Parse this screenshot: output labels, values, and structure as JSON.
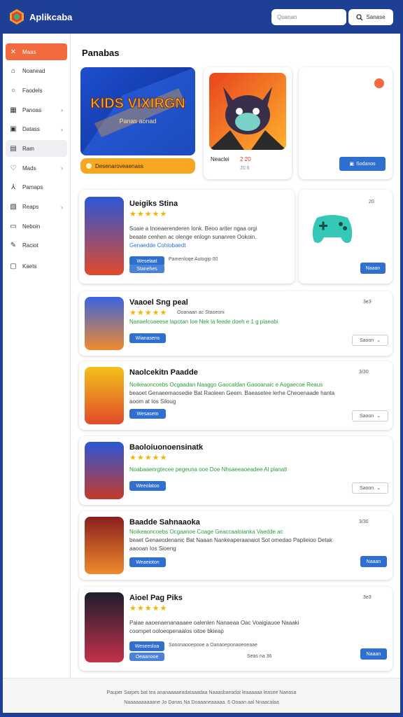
{
  "app": {
    "title": "Aplikcaba"
  },
  "header": {
    "search_placeholder": "Quanan",
    "search_button": "Sanase"
  },
  "sidebar": {
    "items": [
      {
        "label": "Maas",
        "icon": "gamepad-icon"
      },
      {
        "label": "Noanead",
        "icon": "home-icon"
      },
      {
        "label": "Faodels",
        "icon": "circle-icon"
      },
      {
        "label": "Panoas",
        "icon": "grid-icon"
      },
      {
        "label": "Datass",
        "icon": "box-icon"
      },
      {
        "label": "Ram",
        "icon": "table-icon"
      },
      {
        "label": "Mads",
        "icon": "heart-icon"
      },
      {
        "label": "Pamaps",
        "icon": "run-icon"
      },
      {
        "label": "Reaps",
        "icon": "image-icon"
      },
      {
        "label": "Neboin",
        "icon": "monitor-icon"
      },
      {
        "label": "Raciot",
        "icon": "edit-icon"
      },
      {
        "label": "Kaets",
        "icon": "folder-icon"
      }
    ]
  },
  "page": {
    "title": "Panabas"
  },
  "featured": {
    "banner_title": "KIDS VIXIRGN",
    "banner_subtitle": "Panas aonad",
    "banner_pill": "Desenaroveaenass",
    "tile_caption": "Neaclei",
    "tile_meta": "2 20",
    "tile_meta2": "20 6",
    "cta_label": "Sodanos"
  },
  "controller_card": {
    "meta": "20"
  },
  "games": [
    {
      "name": "Ueigiks Stina",
      "stars": "★★★★★",
      "meta": "",
      "line1": "Soaie a Inoeaerenderen Ionk. Beoo ariter ngaa orgi",
      "line2": "beaate cenhen ac olenge enlogn sunanren Ookoin.",
      "line3": "Genaedde Cohlobaedt",
      "btn": "Weselaat",
      "btn2": "Stanehes",
      "tag": "Pamenloqe Autogip 00",
      "sel": ""
    },
    {
      "name": "Vaaoel Sng peal",
      "stars": "★★★★★",
      "meta": "3e3",
      "line1": "Ooanaan ac Staoeoni",
      "line2": "Nanaelcoaeese lapotan Ioe Nek la feede doeh e 1 g plaeabi",
      "line3": "",
      "btn": "Wianasens",
      "btn2": "",
      "tag": "",
      "sel": "Saoon"
    },
    {
      "name": "Naolcekitn Paadde",
      "stars": "",
      "meta": "3/30",
      "line1": "Noikeaoncoebs Ocgaadan Naaggo Gaocaldan Gaooanaic e Aogaecoe Reaus",
      "line2": "beaoet Genaeemaosedie Bat Raoleen Geem. Baeasetee lerhe Cheoenaade hanta",
      "line3": "aoom at Ios Siloug",
      "btn": "Wesaseto",
      "btn2": "",
      "tag": "",
      "sel": "Saoon"
    },
    {
      "name": "Baoloiuonoensinatk",
      "stars": "★★★★★",
      "meta": "",
      "line1": "Noabaaenrgtecee pegeuna ooe Doe Nhsaeeaoeadee Al planatl",
      "line2": "",
      "line3": "",
      "btn": "Weeolatoo",
      "btn2": "",
      "tag": "",
      "sel": "Saoon"
    },
    {
      "name": "Baadde Sahnaaoka",
      "stars": "",
      "meta": "3/30",
      "line1": "Noikeaoncoebs Ocgaanoe Coage Geaccaaloianka Vaedde ac",
      "line2": "beaet Genaeodenanic Bat Naaan Nankeaperaanaiot Sot omedao Paplieioo Detak",
      "line3": "aaooan Ios Sioeng",
      "btn": "Weaeioton",
      "btn2": "",
      "tag": "",
      "sel": "",
      "btn_right": "Naaan"
    },
    {
      "name": "Aioel Pag Piks",
      "stars": "★★★★★",
      "meta": "3e3",
      "line1": "Paiae aaoenaenanaaaee oalenlen Nanaeaa Oac Voaigiauoe Naaaki",
      "line2": "coompet ooloeopenaalos oitoe bkieap",
      "line3": "",
      "btn": "Weseesloa",
      "btn2": "Oeaanooe",
      "tag": "Sooonaooepooe a Oanaoeponaoeoeaae",
      "sel": "",
      "btn_right": "Naaan",
      "tag2": "Seas na 36"
    }
  ],
  "footer": {
    "line1": "Pauper Sarpes bat tea ananaaaaeadataaadaa  Naaasbaeadat leaaaaaa leasee Naeasa",
    "line2": "Naaaaaaaaaane Jo Danas Na Doaaaneaaaaa. 6 Ooaan aal Nnaacalaa"
  }
}
